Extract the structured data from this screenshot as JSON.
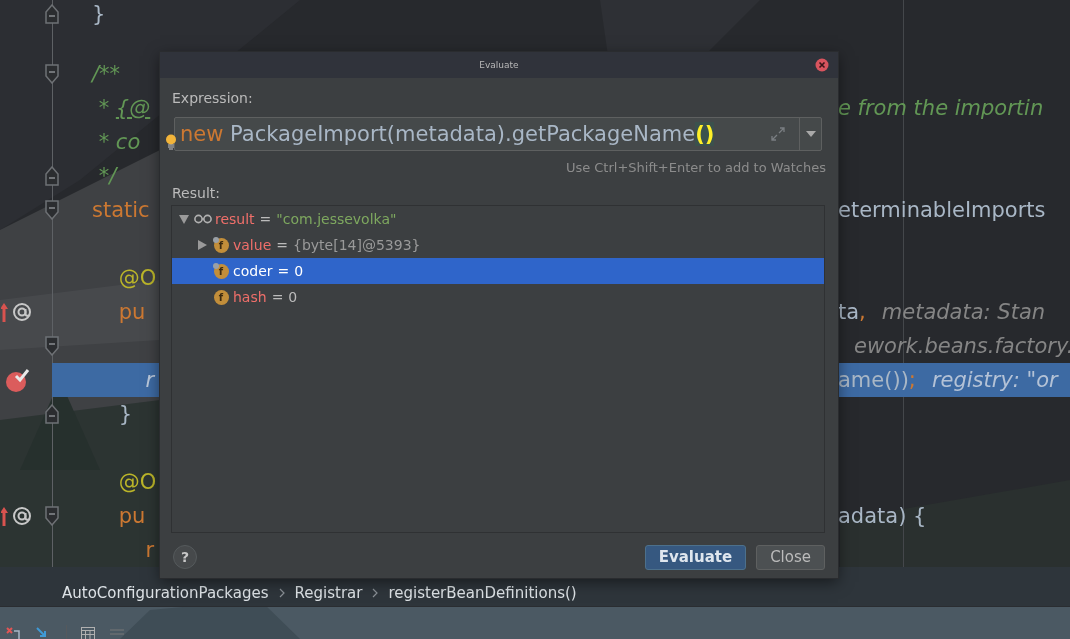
{
  "editor": {
    "lines": [
      {
        "left": [
          {
            "kind": "code",
            "tokens": [
              {
                "text": "}",
                "kind": "plain"
              }
            ]
          }
        ],
        "fold": {
          "kind": "end"
        },
        "highlighted": false
      },
      {
        "highlighted": false
      },
      {
        "left": [
          {
            "kind": "code",
            "tokens": [
              {
                "text": "/**",
                "kind": "comment"
              }
            ]
          }
        ],
        "fold": {
          "kind": "start"
        },
        "highlighted": false
      },
      {
        "left": [
          {
            "kind": "code",
            "tokens": [
              {
                "text": " * ",
                "kind": "comment"
              },
              {
                "text": "{@",
                "kind": "doc-tag"
              }
            ]
          }
        ],
        "right": [
          {
            "kind": "code",
            "tokens": [
              {
                "text": "e from the importin",
                "kind": "comment"
              }
            ]
          }
        ],
        "highlighted": false
      },
      {
        "left": [
          {
            "kind": "code",
            "tokens": [
              {
                "text": " * co",
                "kind": "comment"
              }
            ]
          }
        ],
        "highlighted": false
      },
      {
        "left": [
          {
            "kind": "code",
            "tokens": [
              {
                "text": " */",
                "kind": "comment"
              }
            ]
          }
        ],
        "fold": {
          "kind": "end"
        },
        "highlighted": false
      },
      {
        "left": [
          {
            "kind": "code",
            "tokens": [
              {
                "text": "static",
                "kind": "keyword"
              }
            ]
          }
        ],
        "right": [
          {
            "kind": "code",
            "tokens": [
              {
                "text": "eterminableImports",
                "kind": "plain"
              }
            ]
          }
        ],
        "fold": {
          "kind": "start"
        },
        "highlighted": false
      },
      {
        "highlighted": false
      },
      {
        "left": [
          {
            "kind": "code",
            "tokens": [
              {
                "text": "    @O",
                "kind": "annotation"
              }
            ]
          }
        ],
        "highlighted": false
      },
      {
        "left": [
          {
            "kind": "code",
            "tokens": [
              {
                "text": "    pu",
                "kind": "keyword"
              }
            ]
          }
        ],
        "right": [
          {
            "kind": "code",
            "tokens": [
              {
                "text": "ta",
                "kind": "plain"
              },
              {
                "text": ",",
                "kind": "keyword"
              }
            ]
          },
          {
            "kind": "hint",
            "text": "metadata: Stan"
          }
        ],
        "marker": {
          "kind": "override"
        },
        "highlighted": false
      },
      {
        "right": [
          {
            "kind": "hint",
            "text": "ework.beans.factory."
          }
        ],
        "fold": {
          "kind": "start"
        },
        "highlighted": false
      },
      {
        "left": [
          {
            "kind": "code",
            "tokens": [
              {
                "text": "        r",
                "kind": "param"
              }
            ]
          }
        ],
        "right": [
          {
            "kind": "code",
            "tokens": [
              {
                "text": "ame())",
                "kind": "plain"
              },
              {
                "text": ";",
                "kind": "keyword"
              }
            ]
          },
          {
            "kind": "hint",
            "text": "registry: \"or"
          }
        ],
        "marker": {
          "kind": "breakpoint"
        },
        "highlighted": true
      },
      {
        "left": [
          {
            "kind": "code",
            "tokens": [
              {
                "text": "    }",
                "kind": "plain"
              }
            ]
          }
        ],
        "fold": {
          "kind": "end"
        },
        "highlighted": false
      },
      {
        "highlighted": false
      },
      {
        "left": [
          {
            "kind": "code",
            "tokens": [
              {
                "text": "    @O",
                "kind": "annotation"
              }
            ]
          }
        ],
        "highlighted": false
      },
      {
        "left": [
          {
            "kind": "code",
            "tokens": [
              {
                "text": "    pu",
                "kind": "keyword"
              }
            ]
          }
        ],
        "right": [
          {
            "kind": "code",
            "tokens": [
              {
                "text": "adata) {",
                "kind": "plain"
              }
            ]
          }
        ],
        "marker": {
          "kind": "override"
        },
        "fold": {
          "kind": "start"
        },
        "highlighted": false
      },
      {
        "left": [
          {
            "kind": "code",
            "tokens": [
              {
                "text": "        r",
                "kind": "keyword"
              }
            ]
          }
        ],
        "highlighted": false
      }
    ]
  },
  "dialog": {
    "title": "Evaluate",
    "expression_label": "Expression:",
    "expression": {
      "tokens": [
        {
          "text": "new ",
          "kind": "keyword"
        },
        {
          "text": "PackageImport(metadata).getPackageName",
          "kind": "plain"
        },
        {
          "text": "()",
          "kind": "brace-match"
        }
      ]
    },
    "hint": "Use Ctrl+Shift+Enter to add to Watches",
    "result_label": "Result:",
    "tree": [
      {
        "name": "result",
        "operator": "=",
        "value": {
          "text": "\"com.jessevolka\"",
          "kind": "string"
        },
        "kind": "watch",
        "expanded": true,
        "selected": false,
        "children": [
          {
            "name": "value",
            "operator": "=",
            "value": {
              "text": "{byte[14]@5393}",
              "kind": "reference"
            },
            "kind": "field",
            "badge": "f",
            "final": true,
            "expanded": false,
            "selected": false
          },
          {
            "name": "coder",
            "operator": "=",
            "value": {
              "text": "0",
              "kind": "number"
            },
            "kind": "field",
            "badge": "f",
            "final": true,
            "selected": true
          },
          {
            "name": "hash",
            "operator": "=",
            "value": {
              "text": "0",
              "kind": "number"
            },
            "kind": "field",
            "badge": "f",
            "final": false,
            "selected": false
          }
        ]
      }
    ],
    "help": "?",
    "buttons": [
      {
        "label": "Evaluate",
        "default": true
      },
      {
        "label": "Close",
        "default": false
      }
    ]
  },
  "breadcrumbs": [
    "AutoConfigurationPackages",
    "Registrar",
    "registerBeanDefinitions()"
  ]
}
